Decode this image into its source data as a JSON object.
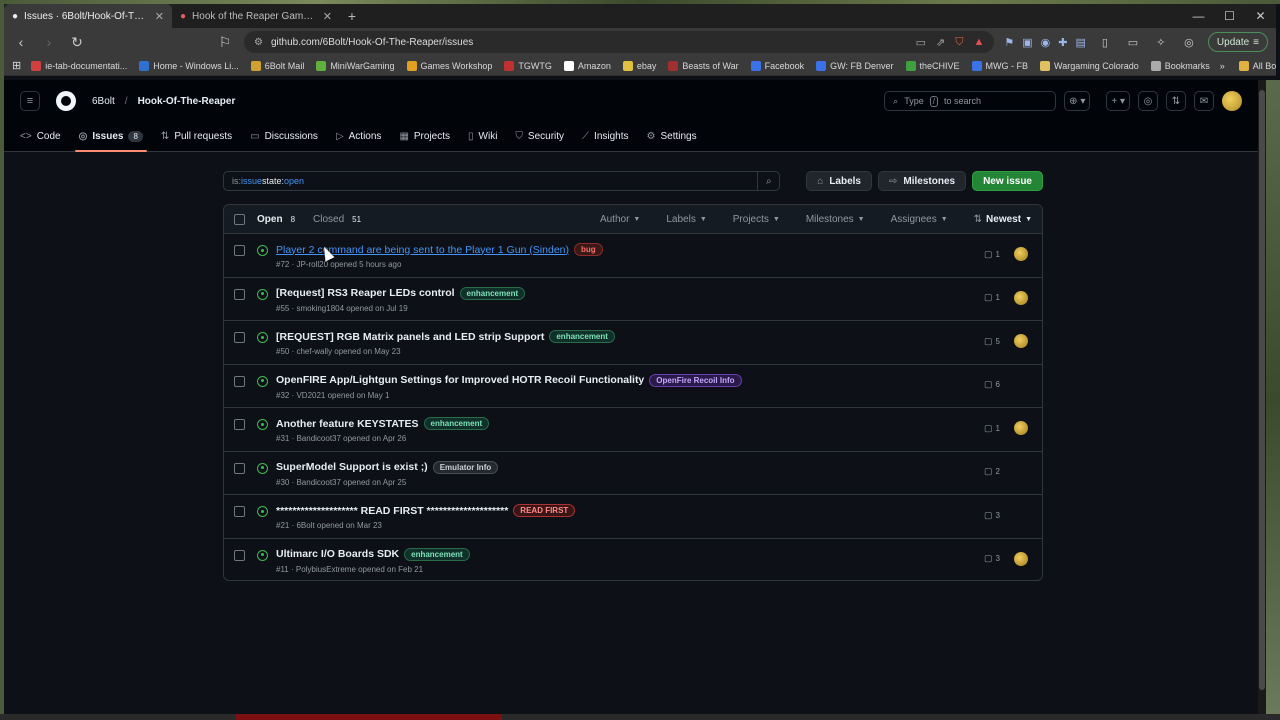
{
  "browser": {
    "tabs": [
      {
        "title": "Issues · 6Bolt/Hook-Of-The-Reaper",
        "active": true
      },
      {
        "title": "Hook of the Reaper GameFiles/Demo",
        "active": false
      }
    ],
    "url": "github.com/6Bolt/Hook-Of-The-Reaper/issues",
    "update_label": "Update",
    "bookmarks": [
      {
        "label": "ie-tab-documentati...",
        "color": "#d04040"
      },
      {
        "label": "Home - Windows Li...",
        "color": "#3070d0"
      },
      {
        "label": "6Bolt Mail",
        "color": "#d0a030"
      },
      {
        "label": "MiniWarGaming",
        "color": "#60b040"
      },
      {
        "label": "Games Workshop",
        "color": "#e0a020"
      },
      {
        "label": "TGWTG",
        "color": "#c03030"
      },
      {
        "label": "Amazon",
        "color": "#ffffff"
      },
      {
        "label": "ebay",
        "color": "#e0c040"
      },
      {
        "label": "Beasts of War",
        "color": "#a03030"
      },
      {
        "label": "Facebook",
        "color": "#3b72e8"
      },
      {
        "label": "GW: FB Denver",
        "color": "#3b72e8"
      },
      {
        "label": "theCHIVE",
        "color": "#40a040"
      },
      {
        "label": "MWG - FB",
        "color": "#3b72e8"
      },
      {
        "label": "Wargaming Colorado",
        "color": "#e0c060"
      },
      {
        "label": "Bookmarks",
        "color": "#aaaaaa"
      }
    ],
    "all_bookmarks": "All Bookmarks"
  },
  "header": {
    "owner": "6Bolt",
    "repo": "Hook-Of-The-Reaper",
    "search_prefix": "Type",
    "search_key": "/",
    "search_suffix": "to search"
  },
  "repo_nav": [
    {
      "label": "Code",
      "icon": "<>",
      "active": false
    },
    {
      "label": "Issues",
      "icon": "◎",
      "active": true,
      "count": "8"
    },
    {
      "label": "Pull requests",
      "icon": "⇅",
      "active": false
    },
    {
      "label": "Discussions",
      "icon": "▭",
      "active": false
    },
    {
      "label": "Actions",
      "icon": "▷",
      "active": false
    },
    {
      "label": "Projects",
      "icon": "▦",
      "active": false
    },
    {
      "label": "Wiki",
      "icon": "▯",
      "active": false
    },
    {
      "label": "Security",
      "icon": "⛉",
      "active": false
    },
    {
      "label": "Insights",
      "icon": "⟋",
      "active": false
    },
    {
      "label": "Settings",
      "icon": "⚙",
      "active": false
    }
  ],
  "filter": {
    "q_is": "is:",
    "q_issue": "issue",
    "q_state": " state:",
    "q_open": "open",
    "labels_btn": "Labels",
    "milestones_btn": "Milestones",
    "new_issue_btn": "New issue"
  },
  "list_header": {
    "open_label": "Open",
    "open_count": "8",
    "closed_label": "Closed",
    "closed_count": "51",
    "filters": [
      "Author",
      "Labels",
      "Projects",
      "Milestones",
      "Assignees"
    ],
    "sort": "Newest"
  },
  "issues": [
    {
      "title": "Player 2 command are being sent to the Player 1 Gun (Sinden)",
      "label": "bug",
      "label_class": "lbl-bug",
      "meta": "#72 · JP-roll20 opened 5 hours ago",
      "comments": "1",
      "assignee": true,
      "hover": true
    },
    {
      "title": "[Request] RS3 Reaper LEDs control",
      "label": "enhancement",
      "label_class": "lbl-enh",
      "meta": "#55 · smoking1804 opened on Jul 19",
      "comments": "1",
      "assignee": true
    },
    {
      "title": "[REQUEST] RGB Matrix panels and LED strip Support",
      "label": "enhancement",
      "label_class": "lbl-enh",
      "meta": "#50 · chef-wally opened on May 23",
      "comments": "5",
      "assignee": true
    },
    {
      "title": "OpenFIRE App/Lightgun Settings for Improved HOTR Recoil Functionality",
      "label": "OpenFire Recoil Info",
      "label_class": "lbl-ofr",
      "meta": "#32 · VD2021 opened on May 1",
      "comments": "6",
      "assignee": false
    },
    {
      "title": "Another feature KEYSTATES",
      "label": "enhancement",
      "label_class": "lbl-enh",
      "meta": "#31 · Bandicoot37 opened on Apr 26",
      "comments": "1",
      "assignee": true
    },
    {
      "title": "SuperModel Support is exist ;)",
      "label": "Emulator Info",
      "label_class": "lbl-emu",
      "meta": "#30 · Bandicoot37 opened on Apr 25",
      "comments": "2",
      "assignee": false
    },
    {
      "title": "******************** READ FIRST ********************",
      "label": "READ FIRST",
      "label_class": "lbl-read",
      "meta": "#21 · 6Bolt opened on Mar 23",
      "comments": "3",
      "assignee": false
    },
    {
      "title": "Ultimarc I/O Boards SDK",
      "label": "enhancement",
      "label_class": "lbl-enh",
      "meta": "#11 · PolybiusExtreme opened on Feb 21",
      "comments": "3",
      "assignee": true
    }
  ]
}
